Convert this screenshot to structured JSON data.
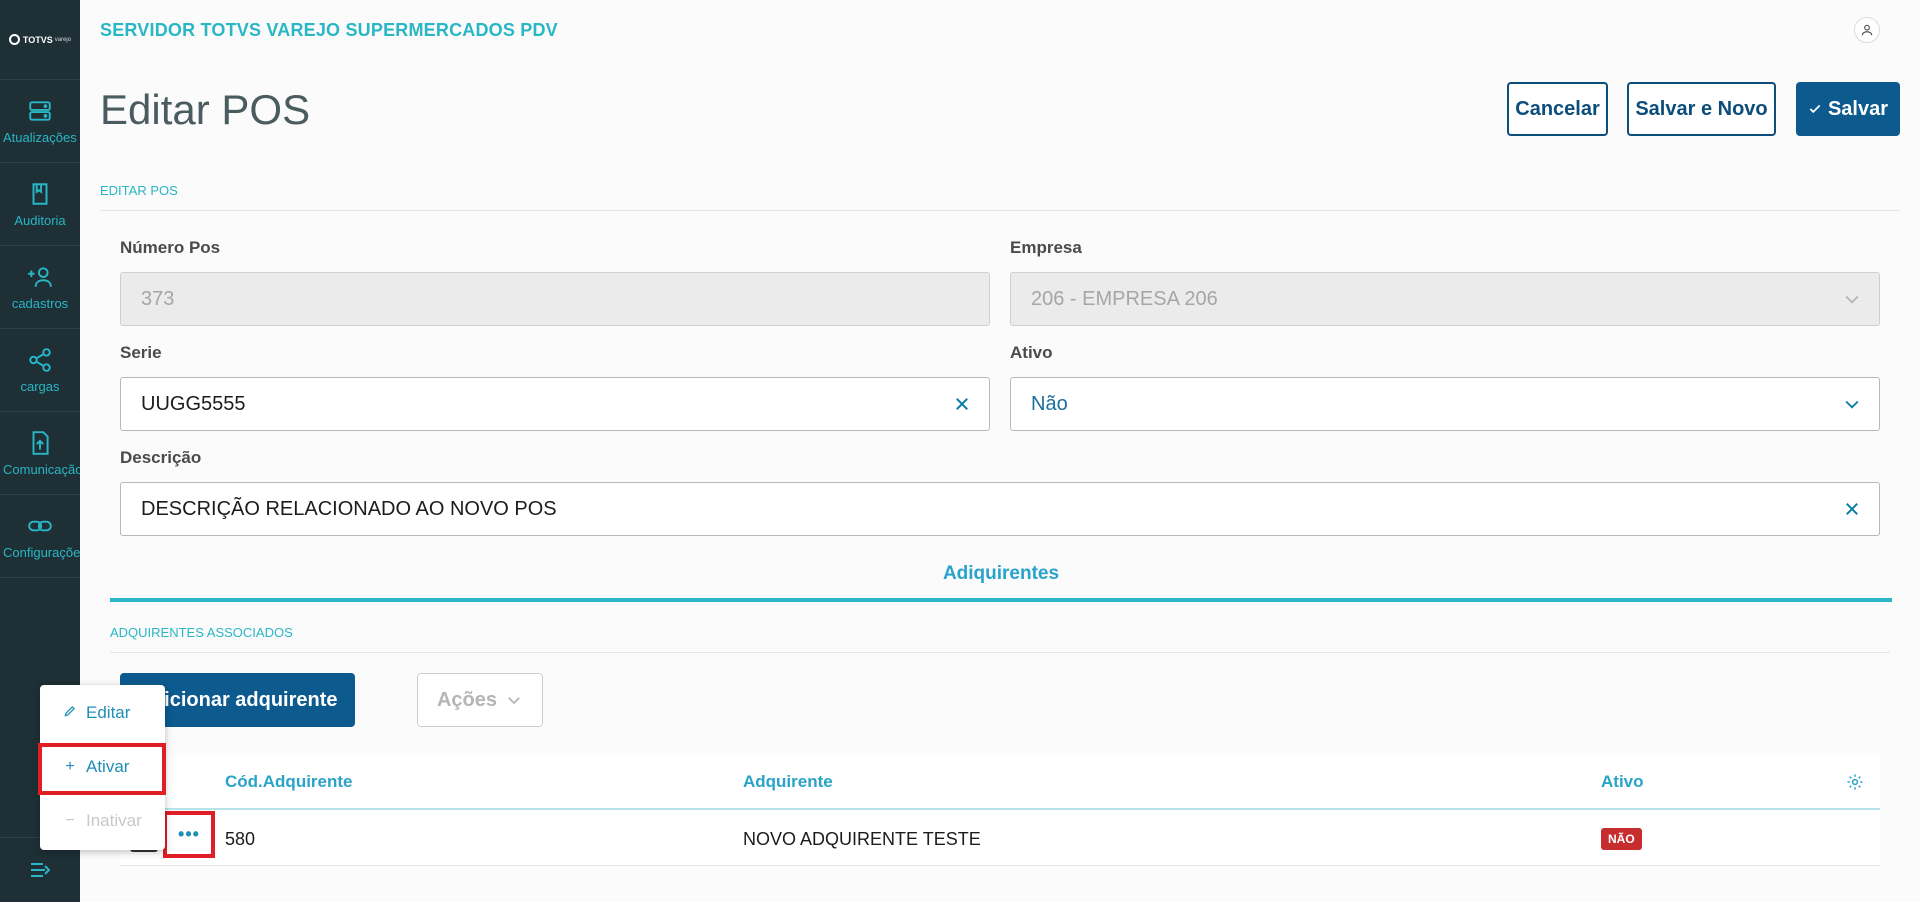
{
  "sidebar": {
    "logo": {
      "brand": "TOTVS",
      "sub": "varejo"
    },
    "items": [
      {
        "label": "Atualizações",
        "icon": "server-icon"
      },
      {
        "label": "Auditoria",
        "icon": "book-icon"
      },
      {
        "label": "cadastros",
        "icon": "add-user-icon"
      },
      {
        "label": "cargas",
        "icon": "share-icon"
      },
      {
        "label": "Comunicação",
        "icon": "upload-file-icon"
      },
      {
        "label": "Configurações",
        "icon": "link-icon"
      }
    ],
    "toggle_icon": "menu-collapse-icon"
  },
  "header": {
    "app_title": "SERVIDOR TOTVS VAREJO SUPERMERCADOS PDV",
    "avatar_icon": "user-icon"
  },
  "page": {
    "title": "Editar POS",
    "buttons": {
      "cancel": "Cancelar",
      "save_new": "Salvar e Novo",
      "save": "Salvar"
    }
  },
  "form": {
    "section_title": "EDITAR POS",
    "numero_pos": {
      "label": "Número Pos",
      "value": "373"
    },
    "empresa": {
      "label": "Empresa",
      "value": "206 - EMPRESA 206"
    },
    "serie": {
      "label": "Serie",
      "value": "UUGG5555"
    },
    "ativo": {
      "label": "Ativo",
      "value": "Não"
    },
    "descricao": {
      "label": "Descrição",
      "value": "DESCRIÇÃO RELACIONADO AO NOVO POS"
    }
  },
  "tabs": [
    {
      "label": "Adiquirentes"
    }
  ],
  "adquirentes": {
    "section_title": "ADQUIRENTES ASSOCIADOS",
    "add_button": "Adicionar adquirente",
    "actions_button": "Ações",
    "columns": [
      "Cód.Adquirente",
      "Adquirente",
      "Ativo"
    ],
    "rows": [
      {
        "codigo": "580",
        "adquirente": "NOVO ADQUIRENTE TESTE",
        "ativo": "NÃO"
      }
    ]
  },
  "row_menu": {
    "items": [
      {
        "label": "Editar",
        "icon": "pencil-icon",
        "enabled": true
      },
      {
        "label": "Ativar",
        "icon": "plus-icon",
        "enabled": true
      },
      {
        "label": "Inativar",
        "icon": "minus-icon",
        "enabled": false
      }
    ]
  },
  "colors": {
    "sidebar_bg": "#1e2f36",
    "accent": "#29b6c5",
    "primary": "#0c5a8e",
    "danger": "#c72c2e",
    "highlight": "#e01e25"
  }
}
